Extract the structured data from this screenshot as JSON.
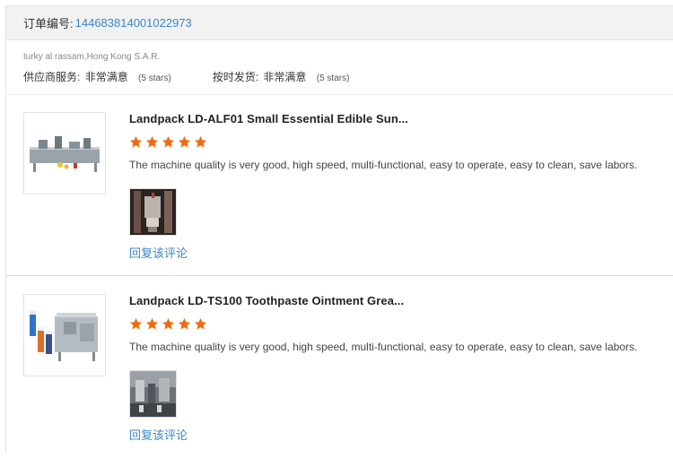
{
  "order": {
    "label": "订单编号:",
    "number": "144683814001022973"
  },
  "buyer": {
    "name": "turky al rassam,Hong Kong S.A.R.",
    "supplier_service_label": "供应商服务:",
    "supplier_service_value": "非常满意",
    "supplier_service_stars": "(5 stars)",
    "on_time_label": "按时发货:",
    "on_time_value": "非常满意",
    "on_time_stars": "(5 stars)"
  },
  "reviews": [
    {
      "title": "Landpack LD-ALF01 Small Essential Edible Sun...",
      "rating": 5,
      "text": "The machine quality is very good, high speed, multi-functional, easy to operate, easy to clean, save labors.",
      "reply_label": "回复该评论"
    },
    {
      "title": "Landpack LD-TS100 Toothpaste Ointment Grea...",
      "rating": 5,
      "text": "The machine quality is very good, high speed, multi-functional, easy to operate, easy to clean, save labors.",
      "reply_label": "回复该评论"
    }
  ],
  "colors": {
    "link": "#3a86c8",
    "star": "#f26a10",
    "header_bg": "#f2f2f2"
  }
}
